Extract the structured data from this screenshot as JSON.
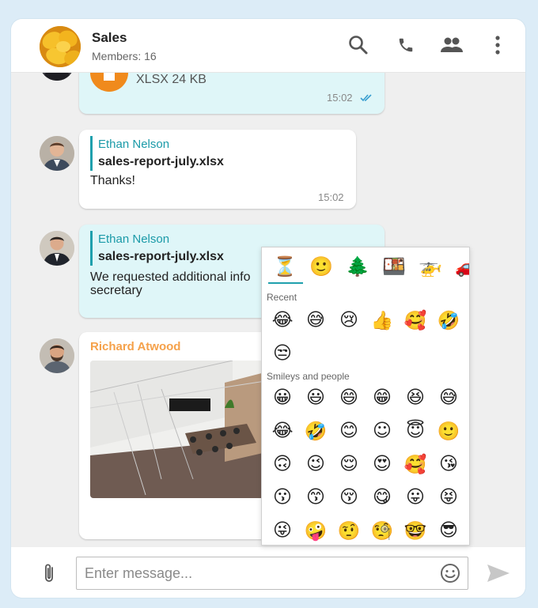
{
  "header": {
    "title": "Sales",
    "subtitle": "Members: 16"
  },
  "messages": {
    "file_msg": {
      "file_info": "XLSX 24 KB",
      "time": "15:02"
    },
    "thanks_msg": {
      "quote_name": "Ethan Nelson",
      "quote_file": "sales-report-july.xlsx",
      "text": "Thanks!",
      "time": "15:02"
    },
    "request_msg": {
      "quote_name": "Ethan Nelson",
      "quote_file": "sales-report-july.xlsx",
      "text_line1": "We requested additional info",
      "text_line2": "secretary"
    },
    "image_msg": {
      "sender": "Richard Atwood"
    }
  },
  "emoji_picker": {
    "categories": [
      "⏳",
      "🙂",
      "🌲",
      "🍱",
      "🚁",
      "🚗"
    ],
    "recent_label": "Recent",
    "recent": [
      "😂",
      "😅",
      "😢",
      "👍",
      "🥰",
      "🤣",
      "😒"
    ],
    "smileys_label": "Smileys and people",
    "smileys": [
      "😀",
      "😃",
      "😄",
      "😁",
      "😆",
      "😅",
      "😂",
      "🤣",
      "😊",
      "☺",
      "😇",
      "🙂",
      "🙃",
      "😉",
      "😌",
      "😍",
      "🥰",
      "😘",
      "😗",
      "😙",
      "😚",
      "😋",
      "😛",
      "😝",
      "😜",
      "🤪",
      "🤨",
      "🧐",
      "🤓",
      "😎"
    ]
  },
  "input": {
    "placeholder": "Enter message..."
  },
  "colors": {
    "accent": "#1fa0ad",
    "outgoing_bubble": "#dff6f8",
    "sender_orange": "#f5a14a",
    "file_icon": "#f08a1c"
  }
}
